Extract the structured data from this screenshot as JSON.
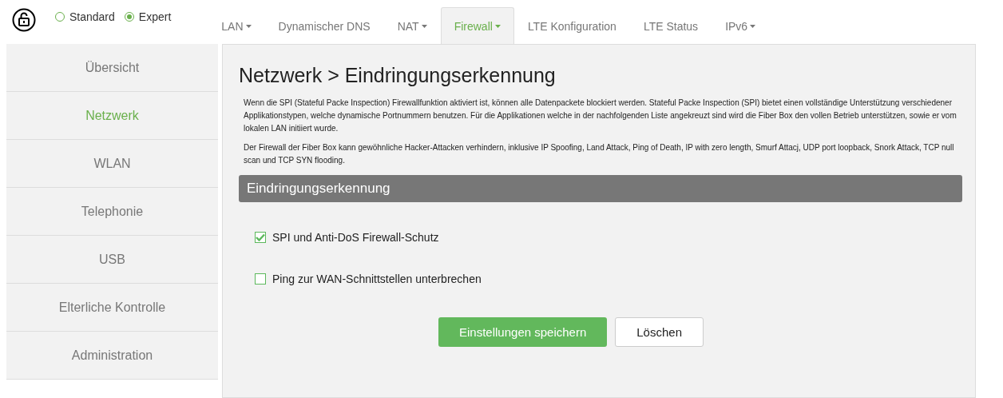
{
  "mode": [
    {
      "label": "Standard",
      "selected": false
    },
    {
      "label": "Expert",
      "selected": true
    }
  ],
  "tabs": [
    {
      "label": "LAN",
      "dropdown": true,
      "selected": false
    },
    {
      "label": "Dynamischer DNS",
      "dropdown": false,
      "selected": false
    },
    {
      "label": "NAT",
      "dropdown": true,
      "selected": false
    },
    {
      "label": "Firewall",
      "dropdown": true,
      "selected": true
    },
    {
      "label": "LTE Konfiguration",
      "dropdown": false,
      "selected": false
    },
    {
      "label": "LTE Status",
      "dropdown": false,
      "selected": false
    },
    {
      "label": "IPv6",
      "dropdown": true,
      "selected": false
    }
  ],
  "sidebar": {
    "items": [
      {
        "label": "Übersicht",
        "selected": false
      },
      {
        "label": "Netzwerk",
        "selected": true
      },
      {
        "label": "WLAN",
        "selected": false
      },
      {
        "label": "Telephonie",
        "selected": false
      },
      {
        "label": "USB",
        "selected": false
      },
      {
        "label": "Elterliche Kontrolle",
        "selected": false
      },
      {
        "label": "Administration",
        "selected": false
      }
    ]
  },
  "page": {
    "title": "Netzwerk > Eindringungserkennung",
    "paragraphs": [
      "Wenn die SPI (Stateful Packe Inspection) Firewallfunktion aktiviert ist, können alle Datenpackete blockiert werden. Stateful Packe Inspection (SPI) bietet einen vollständige Unterstützung verschiedener Applikationstypen, welche dynamische Portnummern benutzen. Für die Applikationen welche in der nachfolgenden Liste angekreuzt sind wird die Fiber Box den vollen Betrieb unterstützen, sowie er vom lokalen LAN initiiert wurde.",
      "Der Firewall der Fiber Box kann gewöhnliche Hacker-Attacken verhindern, inklusive IP Spoofing, Land Attack, Ping of Death, IP with zero length, Smurf Attacj, UDP port loopback, Snork Attack, TCP null scan und TCP SYN flooding."
    ],
    "section": "Eindringungserkennung",
    "options": [
      {
        "label": "SPI und Anti-DoS Firewall-Schutz",
        "checked": true
      },
      {
        "label": "Ping zur WAN-Schnittstellen unterbrechen",
        "checked": false
      }
    ],
    "buttons": [
      {
        "label": "Einstellungen speichern",
        "kind": "primary"
      },
      {
        "label": "Löschen",
        "kind": "secondary"
      }
    ]
  }
}
